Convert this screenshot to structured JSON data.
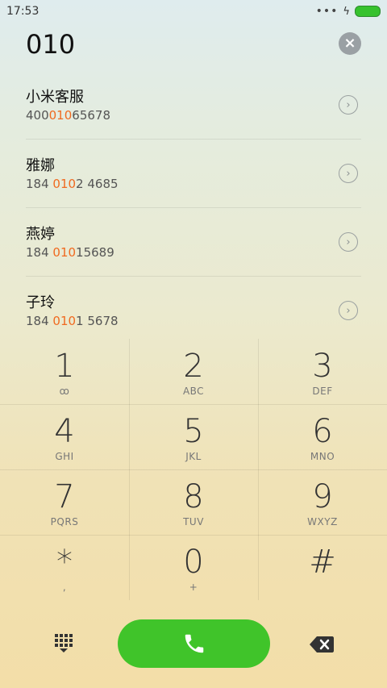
{
  "status": {
    "time": "17:53",
    "dots": "•••",
    "charging": "ϟ"
  },
  "dialed": "010",
  "clear_icon": "×",
  "results": [
    {
      "name": "小米客服",
      "pre": "400",
      "hl": "010",
      "post": "65678"
    },
    {
      "name": "雅娜",
      "pre": "184 ",
      "hl": "010",
      "post": "2 4685"
    },
    {
      "name": "燕婷",
      "pre": "184 ",
      "hl": "010",
      "post": "15689"
    },
    {
      "name": "子玲",
      "pre": "184 ",
      "hl": "010",
      "post": "1 5678"
    }
  ],
  "arrow_icon": "›",
  "keys": [
    {
      "digit": "1",
      "letters": "ꝏ"
    },
    {
      "digit": "2",
      "letters": "ABC"
    },
    {
      "digit": "3",
      "letters": "DEF"
    },
    {
      "digit": "4",
      "letters": "GHI"
    },
    {
      "digit": "5",
      "letters": "JKL"
    },
    {
      "digit": "6",
      "letters": "MNO"
    },
    {
      "digit": "7",
      "letters": "PQRS"
    },
    {
      "digit": "8",
      "letters": "TUV"
    },
    {
      "digit": "9",
      "letters": "WXYZ"
    },
    {
      "digit": "*",
      "letters": ","
    },
    {
      "digit": "0",
      "letters": "+"
    },
    {
      "digit": "#",
      "letters": ""
    }
  ],
  "colors": {
    "call": "#40c42a",
    "highlight": "#f06a20"
  },
  "icons": [
    "dialpad-icon",
    "phone-icon",
    "backspace-icon",
    "voicemail-icon",
    "clear-icon",
    "chevron-right-icon"
  ]
}
